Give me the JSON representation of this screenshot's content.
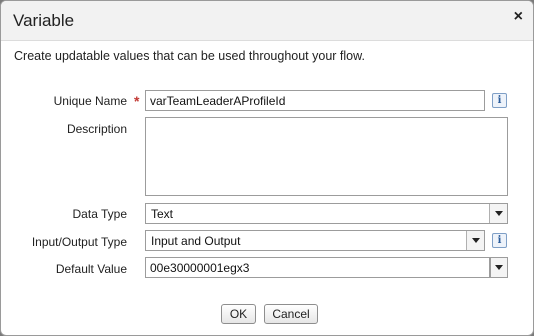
{
  "dialog": {
    "title": "Variable",
    "close_glyph": "×",
    "description": "Create updatable values that can be used throughout your flow."
  },
  "form": {
    "unique_name": {
      "label": "Unique Name",
      "required_mark": "*",
      "value": "varTeamLeaderAProfileId",
      "info_icon": "info-icon"
    },
    "description": {
      "label": "Description",
      "value": ""
    },
    "data_type": {
      "label": "Data Type",
      "selected": "Text"
    },
    "input_output_type": {
      "label": "Input/Output Type",
      "selected": "Input and Output",
      "info_icon": "info-icon"
    },
    "default_value": {
      "label": "Default Value",
      "value": "00e30000001egx3"
    }
  },
  "buttons": {
    "ok": "OK",
    "cancel": "Cancel"
  },
  "info_glyph": "i"
}
